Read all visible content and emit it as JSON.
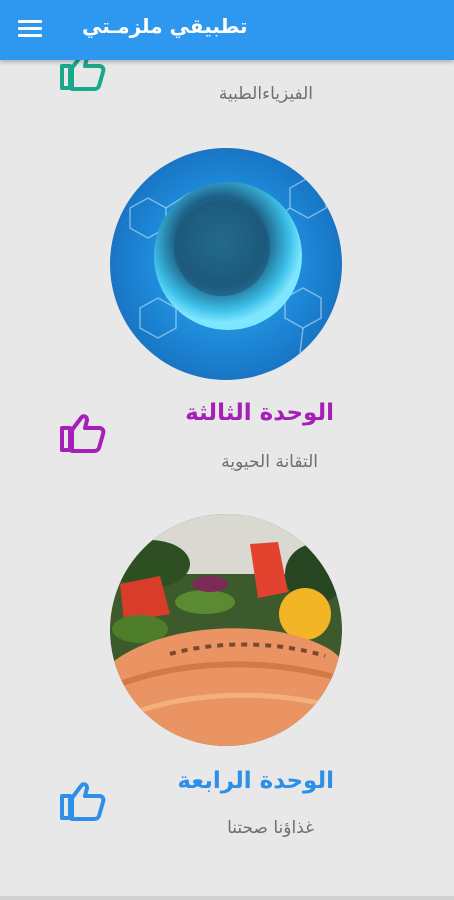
{
  "appbar": {
    "title": "تطبيقي ملزمـتي",
    "menu_icon": "hamburger-menu-icon",
    "color": "#2e97ef"
  },
  "units": [
    {
      "title": "",
      "subtitle": "الفيزياءالطبية",
      "thumb_color": "#1aa88a",
      "icon": "thumbs-up-icon"
    },
    {
      "title": "الوحدة الثالثة",
      "subtitle": "التقانة الحيوية",
      "title_color": "#a51fb8",
      "thumb_color": "#a51fb8",
      "image": "blue-cell-image",
      "icon": "thumbs-up-icon"
    },
    {
      "title": "الوحدة الرابعة",
      "subtitle": "غذاؤنا صحتنا",
      "title_color": "#2e8fe8",
      "thumb_color": "#2e8fe8",
      "image": "salmon-salad-image",
      "icon": "thumbs-up-icon"
    }
  ]
}
